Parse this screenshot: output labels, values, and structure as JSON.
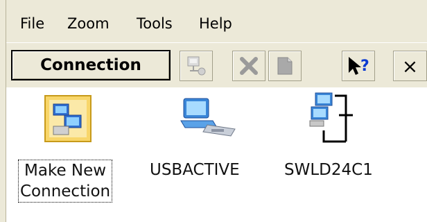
{
  "menu": {
    "file": "File",
    "zoom": "Zoom",
    "tools": "Tools",
    "help": "Help"
  },
  "toolbar": {
    "connection_label": "Connection",
    "close_glyph": "×",
    "help_glyph": "?"
  },
  "items": [
    {
      "label": "Make New\nConnection",
      "icon": "new-connection-icon",
      "selected": true
    },
    {
      "label": "USBACTIVE",
      "icon": "usb-connection-icon",
      "selected": false
    },
    {
      "label": "SWLD24C1",
      "icon": "network-connection-icon",
      "selected": false
    }
  ],
  "colors": {
    "chrome": "#ece9d8",
    "background": "#ffffff"
  }
}
